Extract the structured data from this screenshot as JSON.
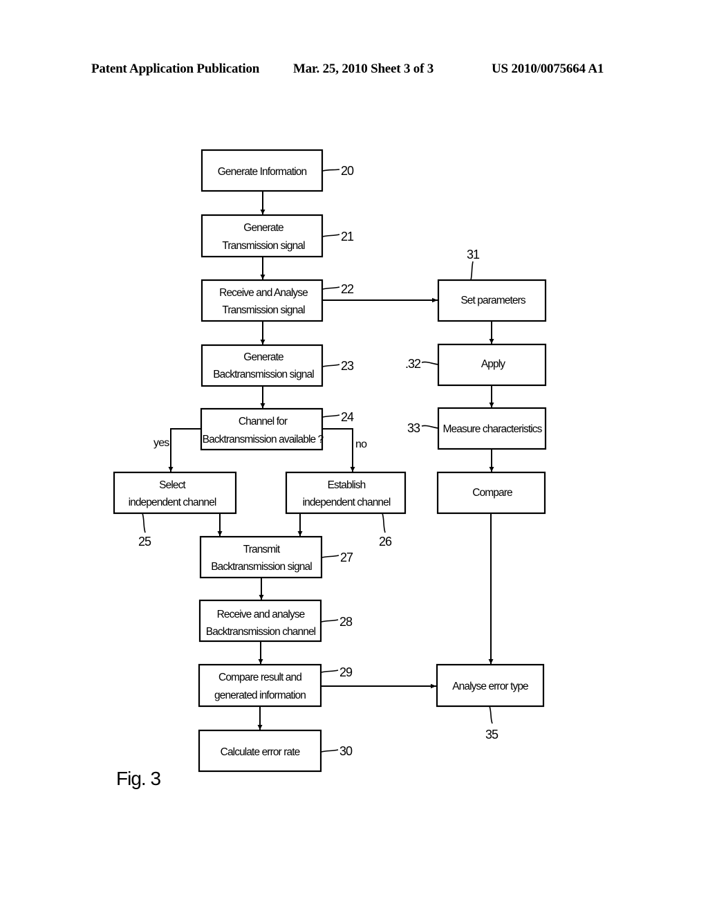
{
  "header": {
    "publication": "Patent Application Publication",
    "date_sheet": "Mar. 25, 2010  Sheet 3 of 3",
    "patent_number": "US 2010/0075664 A1"
  },
  "figure_label": "Fig. 3",
  "steps": [
    {
      "id": "20",
      "lines": [
        "Generate Information"
      ]
    },
    {
      "id": "21",
      "lines": [
        "Generate",
        "Transmission signal"
      ]
    },
    {
      "id": "22",
      "lines": [
        "Receive and Analyse",
        "Transmission signal"
      ]
    },
    {
      "id": "23",
      "lines": [
        "Generate",
        "Backtransmission signal"
      ]
    },
    {
      "id": "24",
      "lines": [
        "Channel for",
        "Backtransmission available ?"
      ]
    },
    {
      "id": "25",
      "lines": [
        "Select",
        "independent channel"
      ]
    },
    {
      "id": "26",
      "lines": [
        "Establish",
        "independent channel"
      ]
    },
    {
      "id": "27",
      "lines": [
        "Transmit",
        "Backtransmission signal"
      ]
    },
    {
      "id": "28",
      "lines": [
        "Receive and analyse",
        "Backtransmission channel"
      ]
    },
    {
      "id": "29",
      "lines": [
        "Compare result and",
        "generated information"
      ]
    },
    {
      "id": "30",
      "lines": [
        "Calculate error rate"
      ]
    },
    {
      "id": "31",
      "lines": [
        "Set parameters"
      ]
    },
    {
      "id": "32",
      "lines": [
        "Apply"
      ]
    },
    {
      "id": "33",
      "lines": [
        "Measure characteristics"
      ]
    },
    {
      "id": "",
      "lines": [
        "Compare"
      ]
    },
    {
      "id": "35",
      "lines": [
        "Analyse error type"
      ]
    }
  ],
  "branch_labels": {
    "yes": "yes",
    "no": "no"
  },
  "ref_labels": {
    "r20": "20",
    "r21": "21",
    "r22": "22",
    "r23": "23",
    "r24": "24",
    "r25": "25",
    "r26": "26",
    "r27": "27",
    "r28": "28",
    "r29": "29",
    "r30": "30",
    "r31": "31",
    "r32": ".32",
    "r33": "33",
    "r35": "35"
  }
}
